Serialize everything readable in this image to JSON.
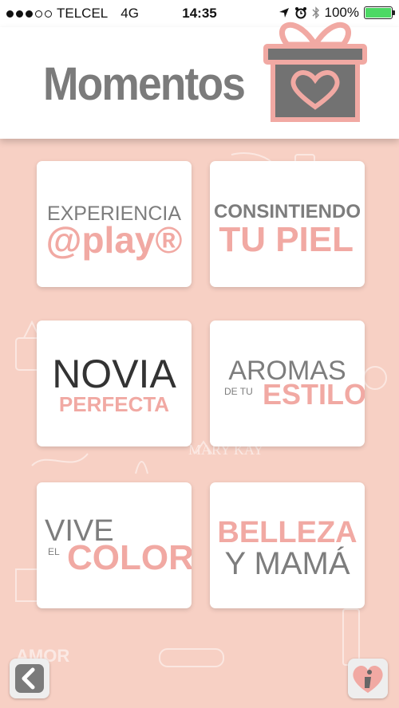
{
  "status_bar": {
    "carrier": "TELCEL",
    "network": "4G",
    "time": "14:35",
    "battery": "100%"
  },
  "header": {
    "title": "Momentos"
  },
  "cards": [
    {
      "line1": "EXPERIENCIA",
      "line2": "@play®"
    },
    {
      "line1": "CONSINTIENDO",
      "line2": "TU PIEL"
    },
    {
      "line1": "NOVIA",
      "line2": "PERFECTA"
    },
    {
      "line1": "AROMAS",
      "line1_small": "DE TU",
      "line2": "ESTILO"
    },
    {
      "line1": "VIVE",
      "line1_small": "EL",
      "line2": "COLOR"
    },
    {
      "line1": "BELLEZA",
      "line2": "Y MAMÁ"
    }
  ],
  "background": {
    "amor": "AMOR",
    "brand": "MARY KAY"
  },
  "colors": {
    "background": "#f7d0c4",
    "accent_pink": "#f1a9a3",
    "grey": "#7d7d7d",
    "battery": "#4cd964"
  }
}
